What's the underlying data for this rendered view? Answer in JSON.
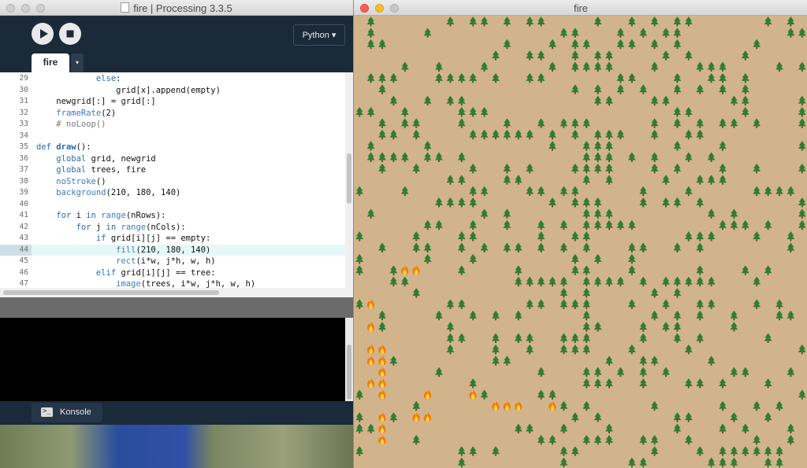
{
  "ide": {
    "title": "fire | Processing 3.3.5",
    "mode": "Python ▾",
    "tabs": [
      {
        "label": "fire"
      }
    ],
    "tab_menu": "▾",
    "console_tab": "Konsole",
    "code": [
      {
        "n": "29",
        "t": "            else:"
      },
      {
        "n": "30",
        "t": "                grid[x].append(empty)"
      },
      {
        "n": "31",
        "t": "    newgrid[:] = grid[:]"
      },
      {
        "n": "32",
        "t": "    frameRate(2)"
      },
      {
        "n": "33",
        "t": "    # noLoop()"
      },
      {
        "n": "34",
        "t": ""
      },
      {
        "n": "35",
        "t": "def draw():"
      },
      {
        "n": "36",
        "t": "    global grid, newgrid"
      },
      {
        "n": "37",
        "t": "    global trees, fire"
      },
      {
        "n": "38",
        "t": "    noStroke()"
      },
      {
        "n": "39",
        "t": "    background(210, 180, 140)"
      },
      {
        "n": "40",
        "t": ""
      },
      {
        "n": "41",
        "t": "    for i in range(nRows):"
      },
      {
        "n": "42",
        "t": "        for j in range(nCols):"
      },
      {
        "n": "43",
        "t": "            if grid[i][j] == empty:"
      },
      {
        "n": "44",
        "t": "                fill(210, 180, 140)"
      },
      {
        "n": "45",
        "t": "                rect(i*w, j*h, w, h)"
      },
      {
        "n": "46",
        "t": "            elif grid[i][j] == tree:"
      },
      {
        "n": "47",
        "t": "                image(trees, i*w, j*h, w, h)"
      }
    ],
    "highlight_line": "44"
  },
  "sketch": {
    "title": "fire",
    "background": "#d2b48c",
    "tree_color": "#2e7d32",
    "fire_color": "#f57c00",
    "grid": {
      "cols": 40,
      "rows": 40
    },
    "fire_cells": [
      [
        4,
        22
      ],
      [
        5,
        22
      ],
      [
        1,
        25
      ],
      [
        1,
        27
      ],
      [
        1,
        29
      ],
      [
        2,
        29
      ],
      [
        1,
        30
      ],
      [
        2,
        30
      ],
      [
        2,
        31
      ],
      [
        1,
        32
      ],
      [
        2,
        32
      ],
      [
        2,
        33
      ],
      [
        6,
        33
      ],
      [
        10,
        33
      ],
      [
        12,
        34
      ],
      [
        13,
        34
      ],
      [
        14,
        34
      ],
      [
        17,
        34
      ],
      [
        2,
        35
      ],
      [
        5,
        35
      ],
      [
        6,
        35
      ],
      [
        2,
        36
      ],
      [
        2,
        37
      ]
    ]
  }
}
